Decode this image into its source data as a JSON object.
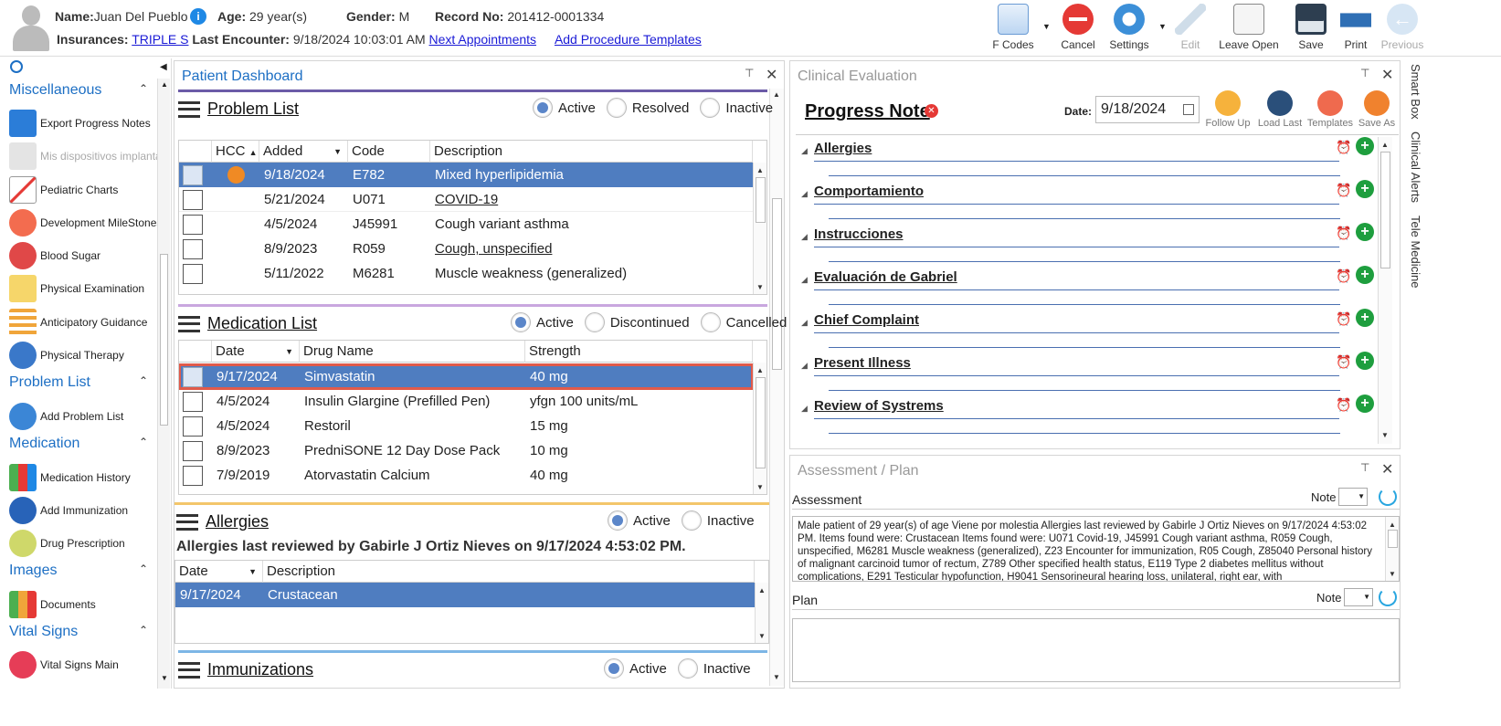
{
  "patient": {
    "name_label": "Name:",
    "name": "Juan Del Pueblo",
    "age_label": "Age:",
    "age": "29 year(s)",
    "gender_label": "Gender:",
    "gender": "M",
    "record_label": "Record No:",
    "record": "201412-0001334",
    "ins_label": "Insurances:",
    "insurance": "TRIPLE S",
    "last_enc_label": "Last Encounter:",
    "last_encounter": "9/18/2024 10:03:01 AM",
    "next_appts": "Next Appointments",
    "add_proc_templates": "Add Procedure Templates"
  },
  "toolbar": {
    "fcodes": "F Codes",
    "cancel": "Cancel",
    "settings": "Settings",
    "edit": "Edit",
    "leave_open": "Leave Open",
    "save": "Save",
    "print": "Print",
    "previous": "Previous"
  },
  "nav": {
    "misc": "Miscellaneous",
    "misc_items": [
      "Export Progress Notes",
      "Mis dispositivos implanta",
      "Pediatric Charts",
      "Development MileStones",
      "Blood Sugar",
      "Physical Examination",
      "Anticipatory Guidance",
      "Physical Therapy"
    ],
    "problem": "Problem List",
    "problem_items": [
      "Add Problem List"
    ],
    "medication": "Medication",
    "medication_items": [
      "Medication History",
      "Add Immunization",
      "Drug Prescription"
    ],
    "images": "Images",
    "images_items": [
      "Documents"
    ],
    "vitals": "Vital Signs",
    "vitals_items": [
      "Vital Signs Main"
    ]
  },
  "dashboard": {
    "title": "Patient Dashboard",
    "problem": {
      "title": "Problem List",
      "filters": [
        "Active",
        "Resolved",
        "Inactive"
      ],
      "cols": [
        "HCC",
        "Added",
        "Code",
        "Description"
      ],
      "rows": [
        {
          "added": "9/18/2024",
          "code": "E782",
          "desc": "Mixed hyperlipidemia"
        },
        {
          "added": "5/21/2024",
          "code": "U071",
          "desc": "COVID-19"
        },
        {
          "added": "4/5/2024",
          "code": "J45991",
          "desc": "Cough variant asthma"
        },
        {
          "added": "8/9/2023",
          "code": "R059",
          "desc": "Cough, unspecified"
        },
        {
          "added": "5/11/2022",
          "code": "M6281",
          "desc": "Muscle weakness (generalized)"
        }
      ]
    },
    "medication": {
      "title": "Medication List",
      "filters": [
        "Active",
        "Discontinued",
        "Cancelled"
      ],
      "cols": [
        "Date",
        "Drug Name",
        "Strength"
      ],
      "rows": [
        {
          "date": "9/17/2024",
          "drug": "Simvastatin",
          "strength": "40 mg"
        },
        {
          "date": "4/5/2024",
          "drug": "Insulin Glargine (Prefilled Pen)",
          "strength": "yfgn 100 units/mL"
        },
        {
          "date": "4/5/2024",
          "drug": "Restoril",
          "strength": "15 mg"
        },
        {
          "date": "8/9/2023",
          "drug": "PredniSONE 12 Day Dose Pack",
          "strength": "10 mg"
        },
        {
          "date": "7/9/2019",
          "drug": "Atorvastatin Calcium",
          "strength": "40 mg"
        }
      ]
    },
    "allergies": {
      "title": "Allergies",
      "filters": [
        "Active",
        "Inactive"
      ],
      "reviewed": "Allergies last reviewed by Gabirle J Ortiz Nieves on 9/17/2024 4:53:02 PM.",
      "cols": [
        "Date",
        "Description"
      ],
      "rows": [
        {
          "date": "9/17/2024",
          "desc": "Crustacean"
        }
      ]
    },
    "immunizations": {
      "title": "Immunizations",
      "filters": [
        "Active",
        "Inactive"
      ]
    }
  },
  "clinical": {
    "title": "Clinical Evaluation",
    "note_title": "Progress Note",
    "date_label": "Date:",
    "date": "9/18/2024",
    "buttons": [
      "Follow Up",
      "Load Last",
      "Templates",
      "Save As"
    ],
    "sections": [
      "Allergies",
      "Comportamiento",
      "Instrucciones",
      "Evaluación de Gabriel",
      "Chief Complaint",
      "Present Illness",
      "Review of Systrems"
    ]
  },
  "assessment": {
    "title": "Assessment / Plan",
    "assessment_label": "Assessment",
    "note_label": "Note",
    "assessment_text": "Male patient of 29 year(s) of age Viene por molestia     Allergies last reviewed by Gabirle J Ortiz Nieves on 9/17/2024 4:53:02 PM.    Items found were:  Crustacean  Items found were:  U071 Covid-19, J45991 Cough variant asthma, R059 Cough, unspecified, M6281 Muscle weakness (generalized), Z23 Encounter for immunization, R05 Cough, Z85040 Personal history of malignant carcinoid tumor of rectum, Z789 Other specified health status, E119 Type 2 diabetes mellitus without complications, E291 Testicular hypofunction, H9041 Sensorineural hearing loss, unilateral, right ear, with",
    "plan_label": "Plan"
  },
  "right_tabs": [
    "Smart Box",
    "Clinical Alerts",
    "Tele Medicine"
  ],
  "colors": {
    "accent": "#1d6fc4",
    "selected_row": "#4f7dc0",
    "highlight_border": "#e05a4a"
  }
}
